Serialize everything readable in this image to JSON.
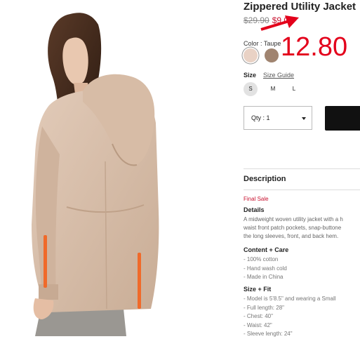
{
  "product": {
    "title": "Zippered Utility Jacket",
    "price_old": "$29.90",
    "price_new": "$9.00",
    "annotation_price": "12.80"
  },
  "color": {
    "label": "Color :",
    "selected": "Taupe",
    "swatches": [
      "#e9d2c5",
      "#a08470"
    ]
  },
  "size": {
    "label": "Size",
    "guide_label": "Size Guide",
    "options": [
      "S",
      "M",
      "L"
    ],
    "selected": "S"
  },
  "qty": {
    "label": "Qty : 1"
  },
  "description": {
    "title": "Description",
    "final_sale": "Final Sale",
    "details_heading": "Details",
    "details_lines": [
      "A midweight woven utility jacket with a h",
      "waist front patch pockets, snap-buttone",
      "the long sleeves, front, and back hem."
    ],
    "content_heading": "Content + Care",
    "content_items": [
      "- 100% cotton",
      "- Hand wash cold",
      "- Made in China"
    ],
    "fit_heading": "Size + Fit",
    "fit_items": [
      "- Model is 5'8.5\" and wearing a Small",
      "- Full length: 28\"",
      "- Chest: 40\"",
      "- Waist: 42\"",
      "- Sleeve length: 24\""
    ]
  },
  "colors": {
    "sale_red": "#c8102e",
    "annotation_red": "#e3001b",
    "button_black": "#111111",
    "jacket": "#d8c0ac",
    "zipper": "#f06a2a"
  },
  "icons": {
    "annotation_arrow": "arrow-icon",
    "qty_caret": "chevron-down-icon"
  }
}
